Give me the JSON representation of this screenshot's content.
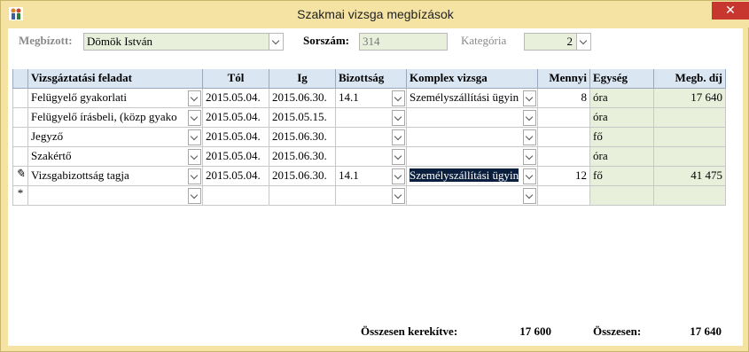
{
  "window": {
    "title": "Szakmai vizsga megbízások"
  },
  "header": {
    "megbizott_label": "Megbízott:",
    "megbizott_value": "Dömök István",
    "sorszam_label": "Sorszám:",
    "sorszam_value": "314",
    "kategoria_label": "Kategória",
    "kategoria_value": "2"
  },
  "table": {
    "columns": [
      "Vizsgáztatási feladat",
      "Tól",
      "Ig",
      "Bizottság",
      "Komplex vizsga",
      "Mennyi",
      "Egység",
      "Megb. díj"
    ],
    "rows": [
      {
        "marker": "",
        "feladat": "Felügyelő  gyakorlati",
        "tol": "2015.05.04.",
        "ig": "2015.06.30.",
        "bizottsag": "14.1",
        "komplex": "Személyszállítási ügyin",
        "mennyi": "8",
        "egyseg": "óra",
        "dij": "17 640"
      },
      {
        "marker": "",
        "feladat": "Felügyelő írásbeli, (közp gyako",
        "tol": "2015.05.04.",
        "ig": "2015.05.15.",
        "bizottsag": "",
        "komplex": "",
        "mennyi": "",
        "egyseg": "óra",
        "dij": ""
      },
      {
        "marker": "",
        "feladat": "Jegyző",
        "tol": "2015.05.04.",
        "ig": "2015.06.30.",
        "bizottsag": "",
        "komplex": "",
        "mennyi": "",
        "egyseg": "fő",
        "dij": ""
      },
      {
        "marker": "",
        "feladat": "Szakértő",
        "tol": "2015.05.04.",
        "ig": "2015.06.30.",
        "bizottsag": "",
        "komplex": "",
        "mennyi": "",
        "egyseg": "óra",
        "dij": ""
      },
      {
        "marker": "✎",
        "feladat": "Vizsgabizottság tagja",
        "tol": "2015.05.04.",
        "ig": "2015.06.30.",
        "bizottsag": "14.1",
        "komplex": "Személyszállítási ügyin",
        "mennyi": "12",
        "egyseg": "fő",
        "dij": "41 475"
      },
      {
        "marker": "*",
        "feladat": "",
        "tol": "",
        "ig": "",
        "bizottsag": "",
        "komplex": "",
        "mennyi": "",
        "egyseg": "",
        "dij": ""
      }
    ]
  },
  "totals": {
    "kerekitve_label": "Összesen kerekítve:",
    "kerekitve_value": "17 600",
    "osszesen_label": "Összesen:",
    "osszesen_value": "17 640"
  },
  "icons": {
    "app": "app-icon",
    "close": "close-icon",
    "dropdown": "chevron-down-icon",
    "edit": "pencil-icon",
    "new_row": "asterisk-icon"
  },
  "colors": {
    "title_bar": "#f4e3a3",
    "close": "#c7372f",
    "header": "#dbe6f3",
    "calc_field": "#e8f0dc",
    "selection": "#0a1f3d"
  }
}
